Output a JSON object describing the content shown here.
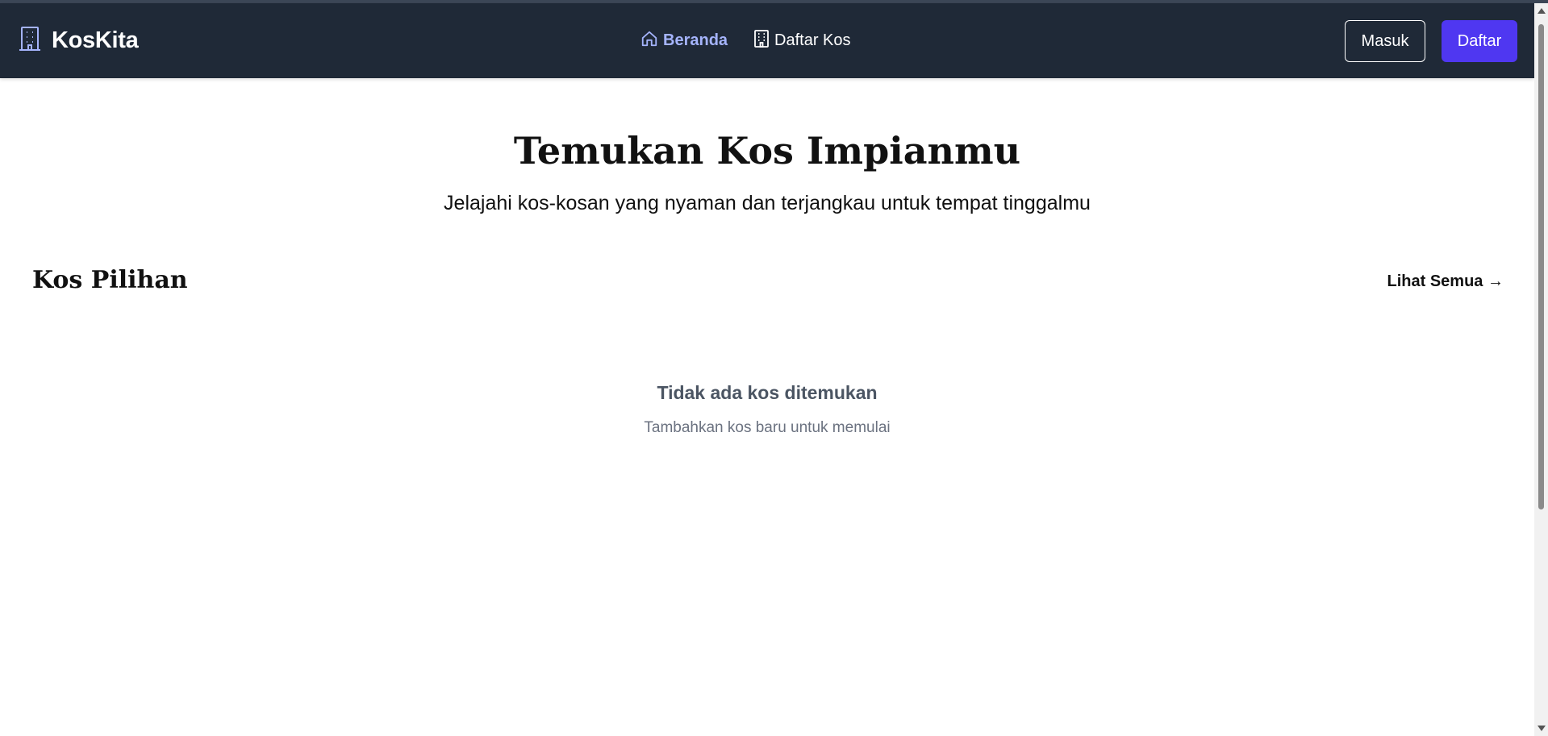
{
  "brand": {
    "name": "KosKita",
    "icon": "building-icon",
    "icon_color": "#a5b4fc"
  },
  "nav": {
    "items": [
      {
        "label": "Beranda",
        "icon": "home-icon",
        "active": true
      },
      {
        "label": "Daftar Kos",
        "icon": "building-icon",
        "active": false
      }
    ]
  },
  "auth": {
    "login_label": "Masuk",
    "register_label": "Daftar"
  },
  "hero": {
    "title": "Temukan Kos Impianmu",
    "subtitle": "Jelajahi kos-kosan yang nyaman dan terjangkau untuk tempat tinggalmu"
  },
  "featured": {
    "title": "Kos Pilihan",
    "see_all_label": "Lihat Semua →",
    "empty_title": "Tidak ada kos ditemukan",
    "empty_subtitle": "Tambahkan kos baru untuk memulai"
  },
  "colors": {
    "navbar_bg": "#1f2937",
    "active_link": "#a5b4fc",
    "primary_button": "#4f37f1"
  }
}
